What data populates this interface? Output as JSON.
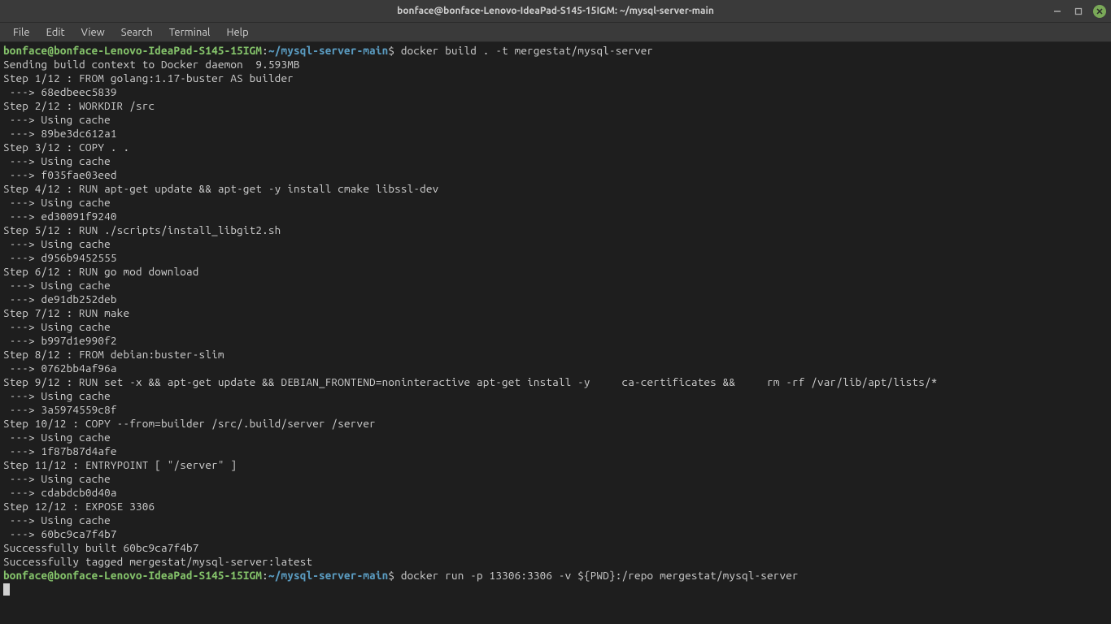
{
  "titlebar": {
    "title": "bonface@bonface-Lenovo-IdeaPad-S145-15IGM: ~/mysql-server-main"
  },
  "menubar": {
    "items": [
      "File",
      "Edit",
      "View",
      "Search",
      "Terminal",
      "Help"
    ]
  },
  "prompt": {
    "user_host": "bonface@bonface-Lenovo-IdeaPad-S145-15IGM",
    "path": "~/mysql-server-main",
    "command1": " docker build . -t mergestat/mysql-server",
    "command2": " docker run -p 13306:3306 -v ${PWD}:/repo mergestat/mysql-server"
  },
  "output": [
    "Sending build context to Docker daemon  9.593MB",
    "Step 1/12 : FROM golang:1.17-buster AS builder",
    " ---> 68edbeec5839",
    "Step 2/12 : WORKDIR /src",
    " ---> Using cache",
    " ---> 89be3dc612a1",
    "Step 3/12 : COPY . .",
    " ---> Using cache",
    " ---> f035fae03eed",
    "Step 4/12 : RUN apt-get update && apt-get -y install cmake libssl-dev",
    " ---> Using cache",
    " ---> ed30091f9240",
    "Step 5/12 : RUN ./scripts/install_libgit2.sh",
    " ---> Using cache",
    " ---> d956b9452555",
    "Step 6/12 : RUN go mod download",
    " ---> Using cache",
    " ---> de91db252deb",
    "Step 7/12 : RUN make",
    " ---> Using cache",
    " ---> b997d1e990f2",
    "Step 8/12 : FROM debian:buster-slim",
    " ---> 0762bb4af96a",
    "Step 9/12 : RUN set -x && apt-get update && DEBIAN_FRONTEND=noninteractive apt-get install -y     ca-certificates &&     rm -rf /var/lib/apt/lists/*",
    " ---> Using cache",
    " ---> 3a5974559c8f",
    "Step 10/12 : COPY --from=builder /src/.build/server /server",
    " ---> Using cache",
    " ---> 1f87b87d4afe",
    "Step 11/12 : ENTRYPOINT [ \"/server\" ]",
    " ---> Using cache",
    " ---> cdabdcb0d40a",
    "Step 12/12 : EXPOSE 3306",
    " ---> Using cache",
    " ---> 60bc9ca7f4b7",
    "Successfully built 60bc9ca7f4b7",
    "Successfully tagged mergestat/mysql-server:latest"
  ]
}
